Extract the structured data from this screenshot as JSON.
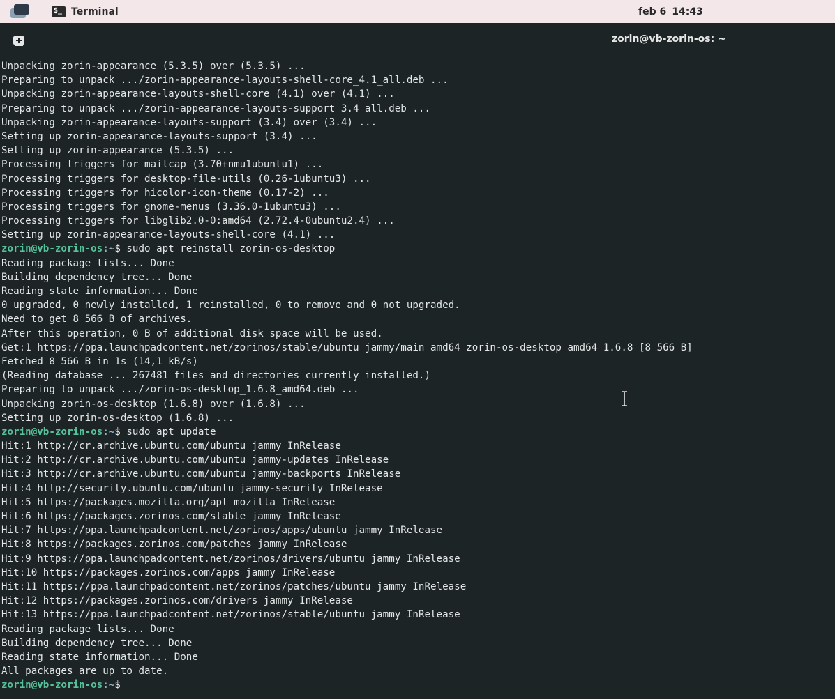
{
  "topbar": {
    "app_name": "Terminal",
    "date": "feb 6",
    "time": "14:43"
  },
  "window": {
    "title": "zorin@vb-zorin-os: ~"
  },
  "prompt": {
    "user_host": "zorin@vb-zorin-os",
    "path": ":~"
  },
  "terminal_lines": [
    {
      "text": "Unpacking zorin-appearance (5.3.5) over (5.3.5) ..."
    },
    {
      "text": "Preparing to unpack .../zorin-appearance-layouts-shell-core_4.1_all.deb ..."
    },
    {
      "text": "Unpacking zorin-appearance-layouts-shell-core (4.1) over (4.1) ..."
    },
    {
      "text": "Preparing to unpack .../zorin-appearance-layouts-support_3.4_all.deb ..."
    },
    {
      "text": "Unpacking zorin-appearance-layouts-support (3.4) over (3.4) ..."
    },
    {
      "text": "Setting up zorin-appearance-layouts-support (3.4) ..."
    },
    {
      "text": "Setting up zorin-appearance (5.3.5) ..."
    },
    {
      "text": "Processing triggers for mailcap (3.70+nmu1ubuntu1) ..."
    },
    {
      "text": "Processing triggers for desktop-file-utils (0.26-1ubuntu3) ..."
    },
    {
      "text": "Processing triggers for hicolor-icon-theme (0.17-2) ..."
    },
    {
      "text": "Processing triggers for gnome-menus (3.36.0-1ubuntu3) ..."
    },
    {
      "text": "Processing triggers for libglib2.0-0:amd64 (2.72.4-0ubuntu2.4) ..."
    },
    {
      "text": "Setting up zorin-appearance-layouts-shell-core (4.1) ..."
    },
    {
      "prompt": true,
      "text": "$ sudo apt reinstall zorin-os-desktop"
    },
    {
      "text": "Reading package lists... Done"
    },
    {
      "text": "Building dependency tree... Done"
    },
    {
      "text": "Reading state information... Done"
    },
    {
      "text": "0 upgraded, 0 newly installed, 1 reinstalled, 0 to remove and 0 not upgraded."
    },
    {
      "text": "Need to get 8 566 B of archives."
    },
    {
      "text": "After this operation, 0 B of additional disk space will be used."
    },
    {
      "text": "Get:1 https://ppa.launchpadcontent.net/zorinos/stable/ubuntu jammy/main amd64 zorin-os-desktop amd64 1.6.8 [8 566 B]"
    },
    {
      "text": "Fetched 8 566 B in 1s (14,1 kB/s)"
    },
    {
      "text": "(Reading database ... 267481 files and directories currently installed.)"
    },
    {
      "text": "Preparing to unpack .../zorin-os-desktop_1.6.8_amd64.deb ..."
    },
    {
      "text": "Unpacking zorin-os-desktop (1.6.8) over (1.6.8) ..."
    },
    {
      "text": "Setting up zorin-os-desktop (1.6.8) ..."
    },
    {
      "prompt": true,
      "text": "$ sudo apt update"
    },
    {
      "text": "Hit:1 http://cr.archive.ubuntu.com/ubuntu jammy InRelease"
    },
    {
      "text": "Hit:2 http://cr.archive.ubuntu.com/ubuntu jammy-updates InRelease"
    },
    {
      "text": "Hit:3 http://cr.archive.ubuntu.com/ubuntu jammy-backports InRelease"
    },
    {
      "text": "Hit:4 http://security.ubuntu.com/ubuntu jammy-security InRelease"
    },
    {
      "text": "Hit:5 https://packages.mozilla.org/apt mozilla InRelease"
    },
    {
      "text": "Hit:6 https://packages.zorinos.com/stable jammy InRelease"
    },
    {
      "text": "Hit:7 https://ppa.launchpadcontent.net/zorinos/apps/ubuntu jammy InRelease"
    },
    {
      "text": "Hit:8 https://packages.zorinos.com/patches jammy InRelease"
    },
    {
      "text": "Hit:9 https://ppa.launchpadcontent.net/zorinos/drivers/ubuntu jammy InRelease"
    },
    {
      "text": "Hit:10 https://packages.zorinos.com/apps jammy InRelease"
    },
    {
      "text": "Hit:11 https://ppa.launchpadcontent.net/zorinos/patches/ubuntu jammy InRelease"
    },
    {
      "text": "Hit:12 https://packages.zorinos.com/drivers jammy InRelease"
    },
    {
      "text": "Hit:13 https://ppa.launchpadcontent.net/zorinos/stable/ubuntu jammy InRelease"
    },
    {
      "text": "Reading package lists... Done"
    },
    {
      "text": "Building dependency tree... Done"
    },
    {
      "text": "Reading state information... Done"
    },
    {
      "text": "All packages are up to date."
    },
    {
      "prompt": true,
      "text": "$ "
    }
  ]
}
